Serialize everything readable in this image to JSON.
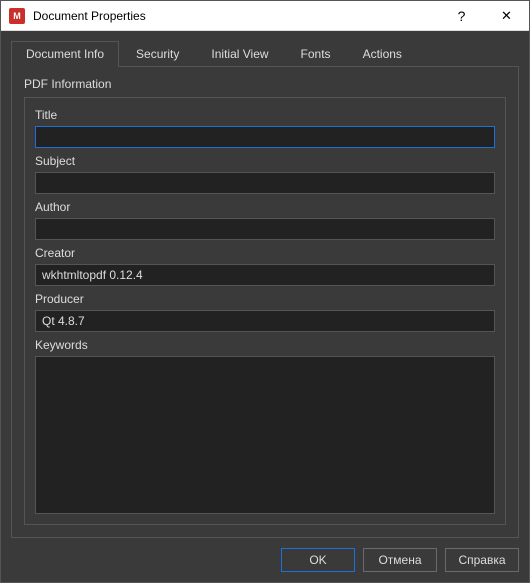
{
  "window": {
    "title": "Document Properties",
    "icon_glyph": "M"
  },
  "tabs": [
    {
      "label": "Document Info",
      "active": true
    },
    {
      "label": "Security",
      "active": false
    },
    {
      "label": "Initial View",
      "active": false
    },
    {
      "label": "Fonts",
      "active": false
    },
    {
      "label": "Actions",
      "active": false
    }
  ],
  "group": {
    "label": "PDF Information"
  },
  "fields": {
    "title": {
      "label": "Title",
      "value": ""
    },
    "subject": {
      "label": "Subject",
      "value": ""
    },
    "author": {
      "label": "Author",
      "value": ""
    },
    "creator": {
      "label": "Creator",
      "value": "wkhtmltopdf 0.12.4"
    },
    "producer": {
      "label": "Producer",
      "value": "Qt 4.8.7"
    },
    "keywords": {
      "label": "Keywords",
      "value": ""
    }
  },
  "buttons": {
    "ok": "OK",
    "cancel": "Отмена",
    "help": "Справка"
  },
  "titlebar_icons": {
    "help_hint": "?",
    "close_hint": "✕"
  }
}
